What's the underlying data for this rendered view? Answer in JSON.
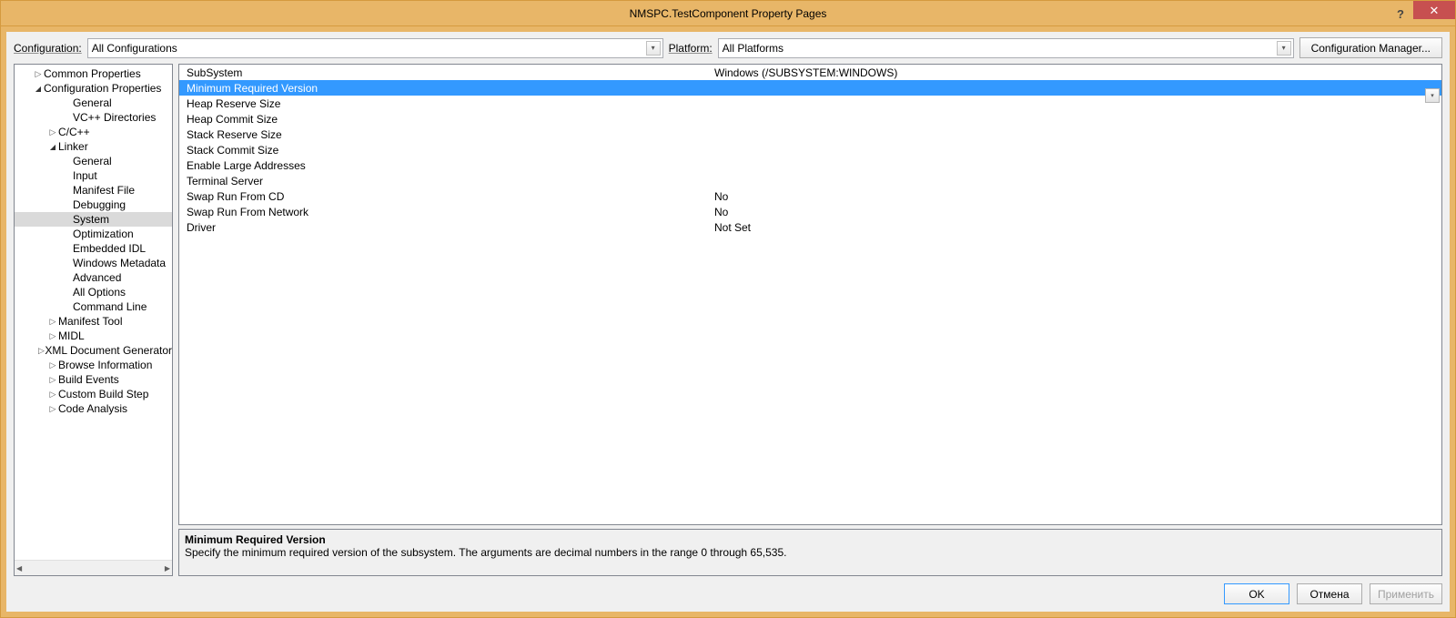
{
  "titlebar": {
    "title": "NMSPC.TestComponent Property Pages",
    "help_glyph": "?",
    "close_glyph": "✕"
  },
  "topbar": {
    "configuration_label": "Configuration:",
    "configuration_value": "All Configurations",
    "platform_label": "Platform:",
    "platform_value": "All Platforms",
    "config_manager_label": "Configuration Manager..."
  },
  "tree": {
    "items": [
      {
        "label": "Common Properties",
        "level": 0,
        "caret": "closed"
      },
      {
        "label": "Configuration Properties",
        "level": 0,
        "caret": "open"
      },
      {
        "label": "General",
        "level": 2,
        "caret": "none"
      },
      {
        "label": "VC++ Directories",
        "level": 2,
        "caret": "none"
      },
      {
        "label": "C/C++",
        "level": 1,
        "caret": "closed"
      },
      {
        "label": "Linker",
        "level": 1,
        "caret": "open"
      },
      {
        "label": "General",
        "level": 2,
        "caret": "none"
      },
      {
        "label": "Input",
        "level": 2,
        "caret": "none"
      },
      {
        "label": "Manifest File",
        "level": 2,
        "caret": "none"
      },
      {
        "label": "Debugging",
        "level": 2,
        "caret": "none"
      },
      {
        "label": "System",
        "level": 2,
        "caret": "none",
        "selected": true
      },
      {
        "label": "Optimization",
        "level": 2,
        "caret": "none"
      },
      {
        "label": "Embedded IDL",
        "level": 2,
        "caret": "none"
      },
      {
        "label": "Windows Metadata",
        "level": 2,
        "caret": "none"
      },
      {
        "label": "Advanced",
        "level": 2,
        "caret": "none"
      },
      {
        "label": "All Options",
        "level": 2,
        "caret": "none"
      },
      {
        "label": "Command Line",
        "level": 2,
        "caret": "none"
      },
      {
        "label": "Manifest Tool",
        "level": 1,
        "caret": "closed"
      },
      {
        "label": "MIDL",
        "level": 1,
        "caret": "closed"
      },
      {
        "label": "XML Document Generator",
        "level": 1,
        "caret": "closed"
      },
      {
        "label": "Browse Information",
        "level": 1,
        "caret": "closed"
      },
      {
        "label": "Build Events",
        "level": 1,
        "caret": "closed"
      },
      {
        "label": "Custom Build Step",
        "level": 1,
        "caret": "closed"
      },
      {
        "label": "Code Analysis",
        "level": 1,
        "caret": "closed"
      }
    ]
  },
  "grid": {
    "rows": [
      {
        "name": "SubSystem",
        "value": "Windows (/SUBSYSTEM:WINDOWS)"
      },
      {
        "name": "Minimum Required Version",
        "value": "",
        "selected": true,
        "dropdown": true
      },
      {
        "name": "Heap Reserve Size",
        "value": ""
      },
      {
        "name": "Heap Commit Size",
        "value": ""
      },
      {
        "name": "Stack Reserve Size",
        "value": ""
      },
      {
        "name": "Stack Commit Size",
        "value": ""
      },
      {
        "name": "Enable Large Addresses",
        "value": ""
      },
      {
        "name": "Terminal Server",
        "value": ""
      },
      {
        "name": "Swap Run From CD",
        "value": "No"
      },
      {
        "name": "Swap Run From Network",
        "value": "No"
      },
      {
        "name": "Driver",
        "value": "Not Set"
      }
    ]
  },
  "desc": {
    "title": "Minimum Required Version",
    "text": "Specify the minimum required version of the subsystem. The arguments are decimal numbers in the range 0 through 65,535."
  },
  "buttons": {
    "ok": "OK",
    "cancel": "Отмена",
    "apply": "Применить"
  }
}
